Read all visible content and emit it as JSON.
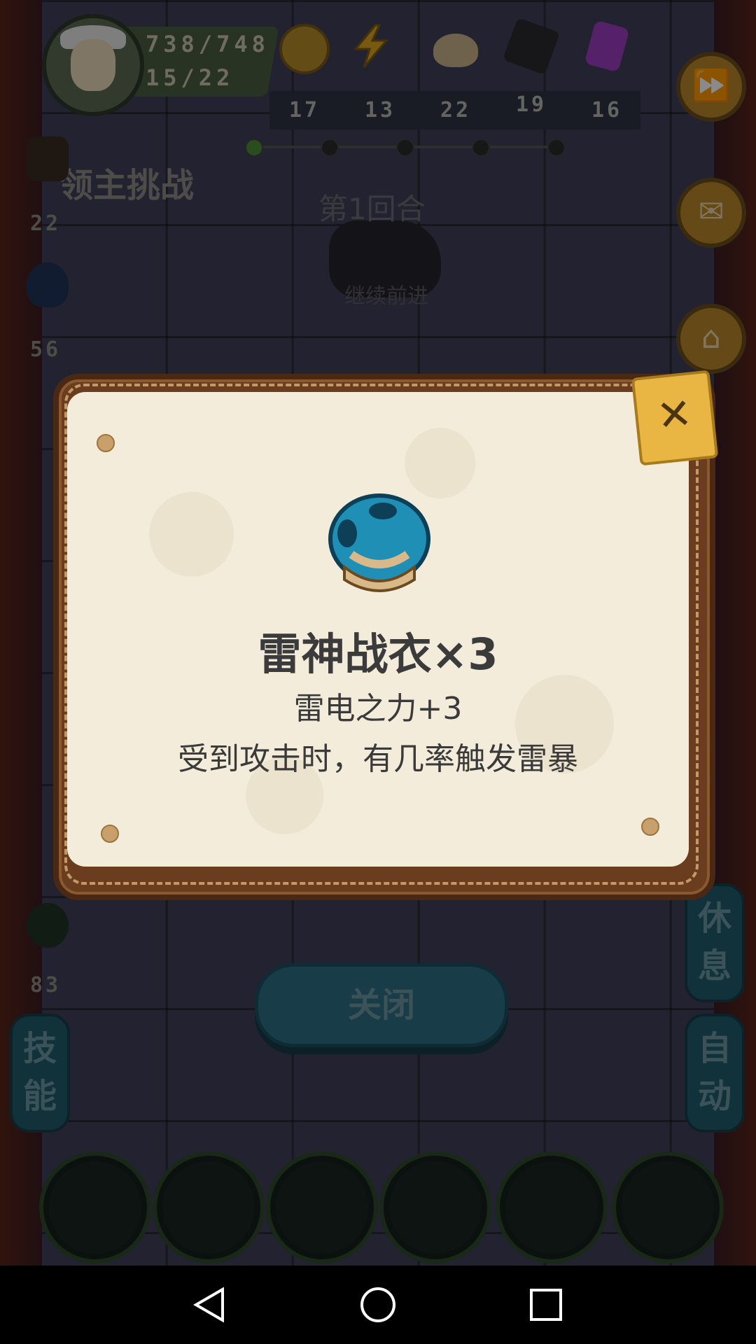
{
  "hud": {
    "hp": "738/748",
    "mp": "15/22",
    "resources": [
      {
        "name": "gold-coin",
        "count": "17",
        "color": "#b68a2a"
      },
      {
        "name": "lightning",
        "count": "13",
        "color": "#d9a21f"
      },
      {
        "name": "bread",
        "count": "22",
        "color": "#c9b28a"
      },
      {
        "name": "ore",
        "count": "19",
        "color": "#2a2a2e"
      },
      {
        "name": "crystal",
        "count": "16",
        "color": "#9b3fbf"
      }
    ]
  },
  "stage": {
    "challenge_title": "领主挑战",
    "round": "第1回合",
    "hint": "继续前进"
  },
  "left_stats": [
    "22",
    "56",
    "83"
  ],
  "right_buttons": {
    "rest": "休息",
    "auto": "自动"
  },
  "left_buttons": {
    "skill": "技能"
  },
  "dialog": {
    "item_name": "雷神战衣×3",
    "effect": "雷电之力+3",
    "description": "受到攻击时，有几率触发雷暴",
    "close_glyph": "✕"
  },
  "close_button": "关闭",
  "colors": {
    "paper": "#f3ecdb",
    "frame": "#6b3d1f",
    "accent_button": "#2d6f86"
  }
}
